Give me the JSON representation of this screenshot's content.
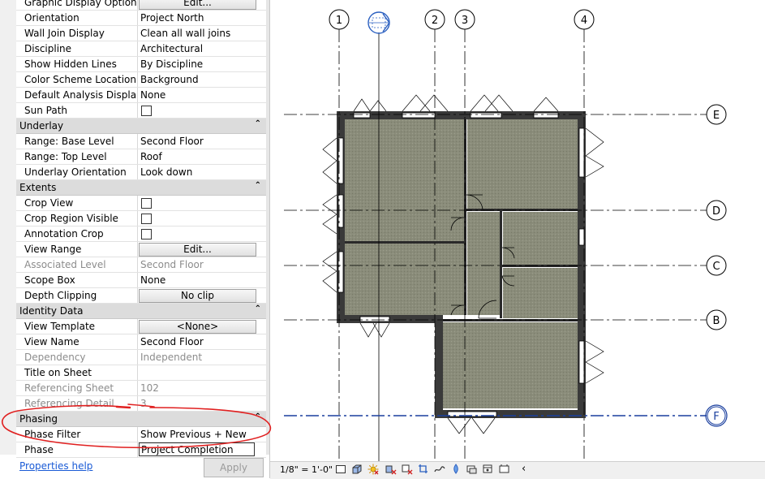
{
  "properties": {
    "rows": [
      {
        "kind": "row",
        "key": "Graphic Display Options",
        "value": "Edit...",
        "type": "button"
      },
      {
        "kind": "row",
        "key": "Orientation",
        "value": "Project North",
        "type": "text"
      },
      {
        "kind": "row",
        "key": "Wall Join Display",
        "value": "Clean all wall joins",
        "type": "text"
      },
      {
        "kind": "row",
        "key": "Discipline",
        "value": "Architectural",
        "type": "text"
      },
      {
        "kind": "row",
        "key": "Show Hidden Lines",
        "value": "By Discipline",
        "type": "text"
      },
      {
        "kind": "row",
        "key": "Color Scheme Location",
        "value": "Background",
        "type": "text"
      },
      {
        "kind": "row",
        "key": "Default Analysis Display ...",
        "value": "None",
        "type": "text"
      },
      {
        "kind": "row",
        "key": "Sun Path",
        "value": "",
        "type": "checkbox"
      },
      {
        "kind": "group",
        "key": "Underlay"
      },
      {
        "kind": "row",
        "key": "Range: Base Level",
        "value": "Second Floor",
        "type": "text"
      },
      {
        "kind": "row",
        "key": "Range: Top Level",
        "value": "Roof",
        "type": "text"
      },
      {
        "kind": "row",
        "key": "Underlay Orientation",
        "value": "Look down",
        "type": "text"
      },
      {
        "kind": "group",
        "key": "Extents"
      },
      {
        "kind": "row",
        "key": "Crop View",
        "value": "",
        "type": "checkbox"
      },
      {
        "kind": "row",
        "key": "Crop Region Visible",
        "value": "",
        "type": "checkbox"
      },
      {
        "kind": "row",
        "key": "Annotation Crop",
        "value": "",
        "type": "checkbox"
      },
      {
        "kind": "row",
        "key": "View Range",
        "value": "Edit...",
        "type": "button"
      },
      {
        "kind": "row",
        "key": "Associated Level",
        "value": "Second Floor",
        "type": "text",
        "disabled": true
      },
      {
        "kind": "row",
        "key": "Scope Box",
        "value": "None",
        "type": "text"
      },
      {
        "kind": "row",
        "key": "Depth Clipping",
        "value": "No clip",
        "type": "button"
      },
      {
        "kind": "group",
        "key": "Identity Data"
      },
      {
        "kind": "row",
        "key": "View Template",
        "value": "<None>",
        "type": "button"
      },
      {
        "kind": "row",
        "key": "View Name",
        "value": "Second Floor",
        "type": "text"
      },
      {
        "kind": "row",
        "key": "Dependency",
        "value": "Independent",
        "type": "text",
        "disabled": true
      },
      {
        "kind": "row",
        "key": "Title on Sheet",
        "value": "",
        "type": "text"
      },
      {
        "kind": "row",
        "key": "Referencing Sheet",
        "value": "102",
        "type": "text",
        "disabled": true
      },
      {
        "kind": "row",
        "key": "Referencing Detail",
        "value": "3",
        "type": "text",
        "disabled": true
      },
      {
        "kind": "group",
        "key": "Phasing"
      },
      {
        "kind": "row",
        "key": "Phase Filter",
        "value": "Show Previous + New",
        "type": "text"
      },
      {
        "kind": "row",
        "key": "Phase",
        "value": "Project Completion",
        "type": "input"
      }
    ],
    "help_link": "Properties help",
    "apply_label": "Apply"
  },
  "grid": {
    "vertical": [
      "1",
      "2",
      "3",
      "4"
    ],
    "horizontal": [
      "E",
      "D",
      "C",
      "B",
      "F"
    ]
  },
  "status": {
    "scale": "1/8\" = 1'-0\""
  },
  "colors": {
    "floor": "#8a8c7a",
    "wall": "#3a3a3a",
    "grid_line": "#000000",
    "selected_grid": "#1a3f9e",
    "annotation": "#e02020",
    "link": "#1a5bd6"
  }
}
